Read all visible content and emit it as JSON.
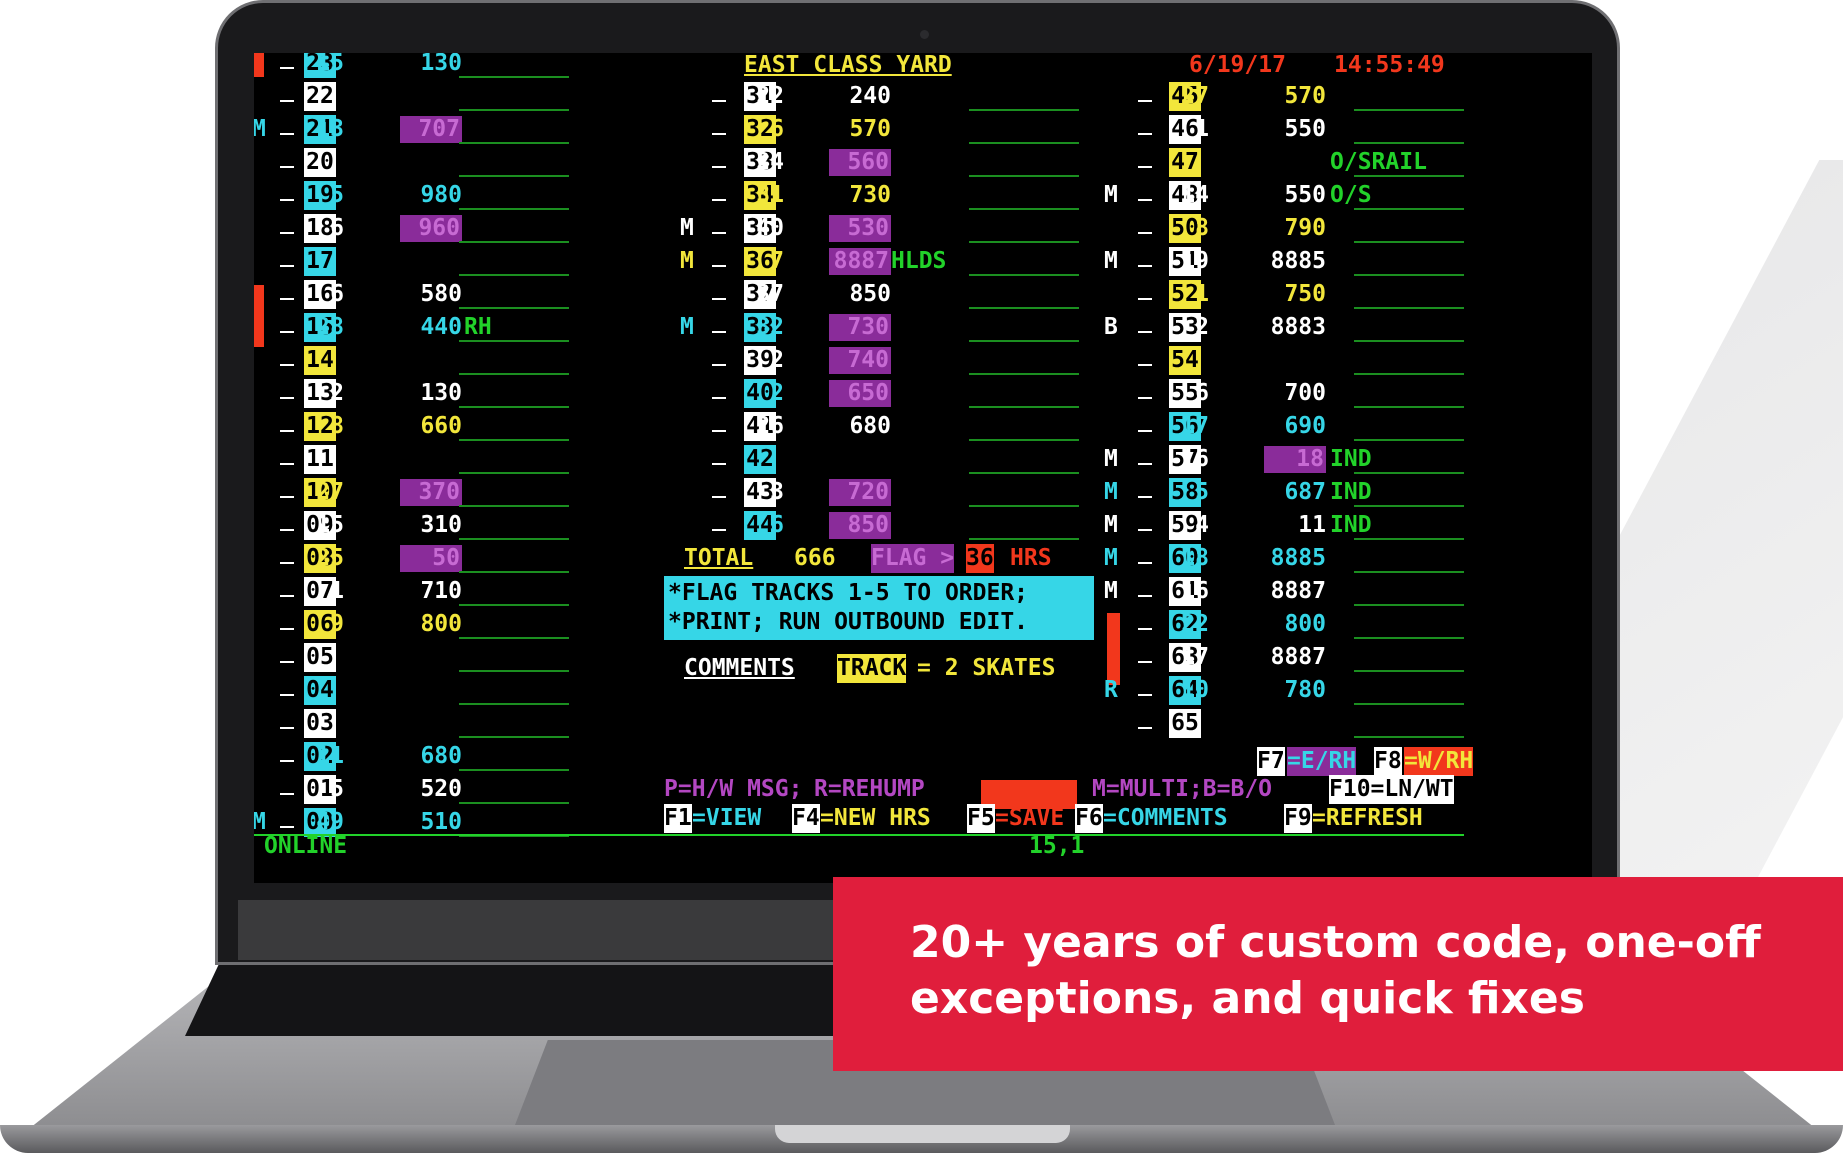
{
  "header": {
    "title": "EAST CLASS YARD",
    "date": "6/19/17",
    "time": "14:55:49"
  },
  "col1": [
    {
      "track": "23",
      "tcolor": "c",
      "cars": "15",
      "ccolor": "c",
      "len": "130",
      "lcolor": "c",
      "box": false,
      "flag": "",
      "note": ""
    },
    {
      "track": "22",
      "tcolor": "w",
      "cars": "",
      "ccolor": "w",
      "len": "",
      "lcolor": "w",
      "box": false,
      "flag": "",
      "note": ""
    },
    {
      "track": "21",
      "tcolor": "c",
      "cars": "13",
      "ccolor": "c",
      "len": "707",
      "lcolor": "m",
      "box": true,
      "flag": "M",
      "note": ""
    },
    {
      "track": "20",
      "tcolor": "w",
      "cars": "",
      "ccolor": "w",
      "len": "",
      "lcolor": "w",
      "box": false,
      "flag": "",
      "note": ""
    },
    {
      "track": "19",
      "tcolor": "c",
      "cars": "5",
      "ccolor": "c",
      "len": "980",
      "lcolor": "c",
      "box": false,
      "flag": "",
      "note": ""
    },
    {
      "track": "18",
      "tcolor": "w",
      "cars": "6",
      "ccolor": "w",
      "len": "960",
      "lcolor": "m",
      "box": true,
      "flag": "",
      "note": ""
    },
    {
      "track": "17",
      "tcolor": "c",
      "cars": "",
      "ccolor": "c",
      "len": "",
      "lcolor": "c",
      "box": false,
      "flag": "",
      "note": ""
    },
    {
      "track": "16",
      "tcolor": "w",
      "cars": "6",
      "ccolor": "w",
      "len": "580",
      "lcolor": "w",
      "box": false,
      "flag": "",
      "note": ""
    },
    {
      "track": "15",
      "tcolor": "c",
      "cars": "28",
      "ccolor": "c",
      "len": "440",
      "lcolor": "c",
      "box": false,
      "flag": "",
      "note": "RH"
    },
    {
      "track": "14",
      "tcolor": "y",
      "cars": "",
      "ccolor": "y",
      "len": "",
      "lcolor": "y",
      "box": false,
      "flag": "",
      "note": ""
    },
    {
      "track": "13",
      "tcolor": "w",
      "cars": "2",
      "ccolor": "w",
      "len": "130",
      "lcolor": "w",
      "box": false,
      "flag": "",
      "note": ""
    },
    {
      "track": "12",
      "tcolor": "y",
      "cars": "8",
      "ccolor": "y",
      "len": "660",
      "lcolor": "y",
      "box": false,
      "flag": "",
      "note": ""
    },
    {
      "track": "11",
      "tcolor": "w",
      "cars": "",
      "ccolor": "w",
      "len": "",
      "lcolor": "w",
      "box": false,
      "flag": "",
      "note": ""
    },
    {
      "track": "10",
      "tcolor": "y",
      "cars": "27",
      "ccolor": "y",
      "len": "370",
      "lcolor": "m",
      "box": true,
      "flag": "",
      "note": ""
    },
    {
      "track": "09",
      "tcolor": "w",
      "cars": "15",
      "ccolor": "w",
      "len": "310",
      "lcolor": "w",
      "box": false,
      "flag": "",
      "note": ""
    },
    {
      "track": "08",
      "tcolor": "y",
      "cars": "25",
      "ccolor": "y",
      "len": "50",
      "lcolor": "m",
      "box": true,
      "flag": "",
      "note": ""
    },
    {
      "track": "07",
      "tcolor": "w",
      "cars": "1",
      "ccolor": "w",
      "len": "710",
      "lcolor": "w",
      "box": false,
      "flag": "",
      "note": ""
    },
    {
      "track": "06",
      "tcolor": "y",
      "cars": "9",
      "ccolor": "y",
      "len": "800",
      "lcolor": "y",
      "box": false,
      "flag": "",
      "note": ""
    },
    {
      "track": "05",
      "tcolor": "w",
      "cars": "",
      "ccolor": "w",
      "len": "",
      "lcolor": "w",
      "box": false,
      "flag": "",
      "note": ""
    },
    {
      "track": "04",
      "tcolor": "c",
      "cars": "",
      "ccolor": "c",
      "len": "",
      "lcolor": "c",
      "box": false,
      "flag": "",
      "note": ""
    },
    {
      "track": "03",
      "tcolor": "w",
      "cars": "",
      "ccolor": "w",
      "len": "",
      "lcolor": "w",
      "box": false,
      "flag": "",
      "note": ""
    },
    {
      "track": "02",
      "tcolor": "c",
      "cars": "11",
      "ccolor": "c",
      "len": "680",
      "lcolor": "c",
      "box": false,
      "flag": "",
      "note": ""
    },
    {
      "track": "01",
      "tcolor": "w",
      "cars": "5",
      "ccolor": "w",
      "len": "520",
      "lcolor": "w",
      "box": false,
      "flag": "",
      "note": ""
    },
    {
      "track": "00",
      "tcolor": "c",
      "cars": "49",
      "ccolor": "c",
      "len": "510",
      "lcolor": "c",
      "box": false,
      "flag": "M",
      "note": ""
    }
  ],
  "col2": [
    {
      "track": "31",
      "tcolor": "w",
      "cars": "22",
      "ccolor": "w",
      "len": "240",
      "lcolor": "w",
      "box": false,
      "flag": "",
      "flagcolor": "",
      "note": ""
    },
    {
      "track": "32",
      "tcolor": "y",
      "cars": "6",
      "ccolor": "y",
      "len": "570",
      "lcolor": "y",
      "box": false,
      "flag": "",
      "flagcolor": "",
      "note": ""
    },
    {
      "track": "33",
      "tcolor": "w",
      "cars": "24",
      "ccolor": "w",
      "len": "560",
      "lcolor": "m",
      "box": true,
      "flag": "",
      "flagcolor": "",
      "note": ""
    },
    {
      "track": "34",
      "tcolor": "y",
      "cars": "31",
      "ccolor": "y",
      "len": "730",
      "lcolor": "y",
      "box": false,
      "flag": "",
      "flagcolor": "",
      "note": ""
    },
    {
      "track": "35",
      "tcolor": "w",
      "cars": "40",
      "ccolor": "w",
      "len": "530",
      "lcolor": "m",
      "box": true,
      "flag": "M",
      "flagcolor": "w",
      "note": ""
    },
    {
      "track": "36",
      "tcolor": "y",
      "cars": "7",
      "ccolor": "y",
      "len": "8887",
      "lcolor": "m",
      "box": true,
      "flag": "M",
      "flagcolor": "y",
      "note": "HLDS"
    },
    {
      "track": "37",
      "tcolor": "w",
      "cars": "37",
      "ccolor": "w",
      "len": "850",
      "lcolor": "w",
      "box": false,
      "flag": "",
      "flagcolor": "",
      "note": ""
    },
    {
      "track": "38",
      "tcolor": "c",
      "cars": "32",
      "ccolor": "c",
      "len": "730",
      "lcolor": "m",
      "box": true,
      "flag": "M",
      "flagcolor": "c",
      "note": ""
    },
    {
      "track": "39",
      "tcolor": "w",
      "cars": "2",
      "ccolor": "w",
      "len": "740",
      "lcolor": "m",
      "box": true,
      "flag": "",
      "flagcolor": "",
      "note": ""
    },
    {
      "track": "40",
      "tcolor": "c",
      "cars": "2",
      "ccolor": "c",
      "len": "650",
      "lcolor": "m",
      "box": true,
      "flag": "",
      "flagcolor": "",
      "note": ""
    },
    {
      "track": "41",
      "tcolor": "w",
      "cars": "26",
      "ccolor": "w",
      "len": "680",
      "lcolor": "w",
      "box": false,
      "flag": "",
      "flagcolor": "",
      "note": ""
    },
    {
      "track": "42",
      "tcolor": "c",
      "cars": "",
      "ccolor": "c",
      "len": "",
      "lcolor": "c",
      "box": false,
      "flag": "",
      "flagcolor": "",
      "note": ""
    },
    {
      "track": "43",
      "tcolor": "w",
      "cars": "3",
      "ccolor": "w",
      "len": "720",
      "lcolor": "m",
      "box": true,
      "flag": "",
      "flagcolor": "",
      "note": ""
    },
    {
      "track": "44",
      "tcolor": "c",
      "cars": "6",
      "ccolor": "c",
      "len": "850",
      "lcolor": "m",
      "box": true,
      "flag": "",
      "flagcolor": "",
      "note": ""
    }
  ],
  "col3": [
    {
      "track": "45",
      "tcolor": "y",
      "cars": "27",
      "ccolor": "y",
      "len": "570",
      "lcolor": "y",
      "box": false,
      "flag": "",
      "flagcolor": "",
      "note": ""
    },
    {
      "track": "46",
      "tcolor": "w",
      "cars": "1",
      "ccolor": "w",
      "len": "550",
      "lcolor": "w",
      "box": false,
      "flag": "",
      "flagcolor": "",
      "note": ""
    },
    {
      "track": "47",
      "tcolor": "y",
      "cars": "",
      "ccolor": "y",
      "len": "",
      "lcolor": "y",
      "box": false,
      "flag": "",
      "flagcolor": "",
      "note": "O/SRAIL"
    },
    {
      "track": "48",
      "tcolor": "w",
      "cars": "14",
      "ccolor": "w",
      "len": "550",
      "lcolor": "w",
      "box": false,
      "flag": "M",
      "flagcolor": "w",
      "note": "O/S"
    },
    {
      "track": "50",
      "tcolor": "y",
      "cars": "8",
      "ccolor": "y",
      "len": "790",
      "lcolor": "y",
      "box": false,
      "flag": "",
      "flagcolor": "",
      "note": ""
    },
    {
      "track": "51",
      "tcolor": "w",
      "cars": "19",
      "ccolor": "w",
      "len": "8885",
      "lcolor": "w",
      "box": false,
      "flag": "M",
      "flagcolor": "w",
      "note": ""
    },
    {
      "track": "52",
      "tcolor": "y",
      "cars": "1",
      "ccolor": "y",
      "len": "750",
      "lcolor": "y",
      "box": false,
      "flag": "",
      "flagcolor": "",
      "note": ""
    },
    {
      "track": "53",
      "tcolor": "w",
      "cars": "2",
      "ccolor": "w",
      "len": "8883",
      "lcolor": "w",
      "box": false,
      "flag": "B",
      "flagcolor": "w",
      "note": ""
    },
    {
      "track": "54",
      "tcolor": "y",
      "cars": "",
      "ccolor": "y",
      "len": "",
      "lcolor": "y",
      "box": false,
      "flag": "",
      "flagcolor": "",
      "note": ""
    },
    {
      "track": "55",
      "tcolor": "w",
      "cars": "6",
      "ccolor": "w",
      "len": "700",
      "lcolor": "w",
      "box": false,
      "flag": "",
      "flagcolor": "",
      "note": ""
    },
    {
      "track": "56",
      "tcolor": "c",
      "cars": "17",
      "ccolor": "c",
      "len": "690",
      "lcolor": "c",
      "box": false,
      "flag": "",
      "flagcolor": "",
      "note": ""
    },
    {
      "track": "57",
      "tcolor": "w",
      "cars": "16",
      "ccolor": "w",
      "len": "18",
      "lcolor": "m",
      "box": true,
      "flag": "M",
      "flagcolor": "w",
      "note": "IND"
    },
    {
      "track": "58",
      "tcolor": "c",
      "cars": "5",
      "ccolor": "c",
      "len": "687",
      "lcolor": "c",
      "box": false,
      "flag": "M",
      "flagcolor": "c",
      "note": "IND"
    },
    {
      "track": "59",
      "tcolor": "w",
      "cars": "4",
      "ccolor": "w",
      "len": "11",
      "lcolor": "w",
      "box": false,
      "flag": "M",
      "flagcolor": "w",
      "note": "IND"
    },
    {
      "track": "60",
      "tcolor": "c",
      "cars": "18",
      "ccolor": "c",
      "len": "8885",
      "lcolor": "c",
      "box": false,
      "flag": "M",
      "flagcolor": "c",
      "note": ""
    },
    {
      "track": "61",
      "tcolor": "w",
      "cars": "16",
      "ccolor": "w",
      "len": "8887",
      "lcolor": "w",
      "box": false,
      "flag": "M",
      "flagcolor": "w",
      "note": ""
    },
    {
      "track": "62",
      "tcolor": "c",
      "cars": "22",
      "ccolor": "c",
      "len": "800",
      "lcolor": "c",
      "box": false,
      "flag": "",
      "flagcolor": "",
      "note": ""
    },
    {
      "track": "63",
      "tcolor": "w",
      "cars": "17",
      "ccolor": "w",
      "len": "8887",
      "lcolor": "w",
      "box": false,
      "flag": "",
      "flagcolor": "",
      "note": ""
    },
    {
      "track": "64",
      "tcolor": "c",
      "cars": "10",
      "ccolor": "c",
      "len": "780",
      "lcolor": "c",
      "box": false,
      "flag": "R",
      "flagcolor": "c",
      "note": ""
    },
    {
      "track": "65",
      "tcolor": "w",
      "cars": "",
      "ccolor": "w",
      "len": "",
      "lcolor": "w",
      "box": false,
      "flag": "",
      "flagcolor": "",
      "note": ""
    }
  ],
  "totals": {
    "total_label": "TOTAL",
    "total_value": "666",
    "flag_label": "FLAG >",
    "flag_value": "36",
    "hrs_label": "HRS"
  },
  "message": {
    "line1": "*FLAG TRACKS 1-5 TO ORDER;",
    "line2": "*PRINT; RUN OUTBOUND EDIT."
  },
  "comments": {
    "label": "COMMENTS",
    "track": "TRACK",
    "skates": "= 2 SKATES"
  },
  "legend": {
    "ph": "P=H/W MSG;",
    "rr": "R=REHUMP",
    "mm": "M=MULTI;B=B/O"
  },
  "keys": {
    "f7": "F7",
    "f7v": "=E/RH",
    "f8": "F8",
    "f8v": "=W/RH",
    "f10": "F10=LN/WT",
    "f1": "F1",
    "f1v": "=VIEW",
    "f4": "F4",
    "f4v": "=NEW HRS",
    "f5": "F5",
    "f5v": "=SAVE",
    "f6": "F6",
    "f6v": "=COMMENTS",
    "f9": "F9",
    "f9v": "=REFRESH"
  },
  "status": {
    "online": "ONLINE",
    "cursor": "15,1"
  },
  "banner": {
    "line1": "20+ years of custom code, one-off",
    "line2": "exceptions, and quick fixes"
  }
}
